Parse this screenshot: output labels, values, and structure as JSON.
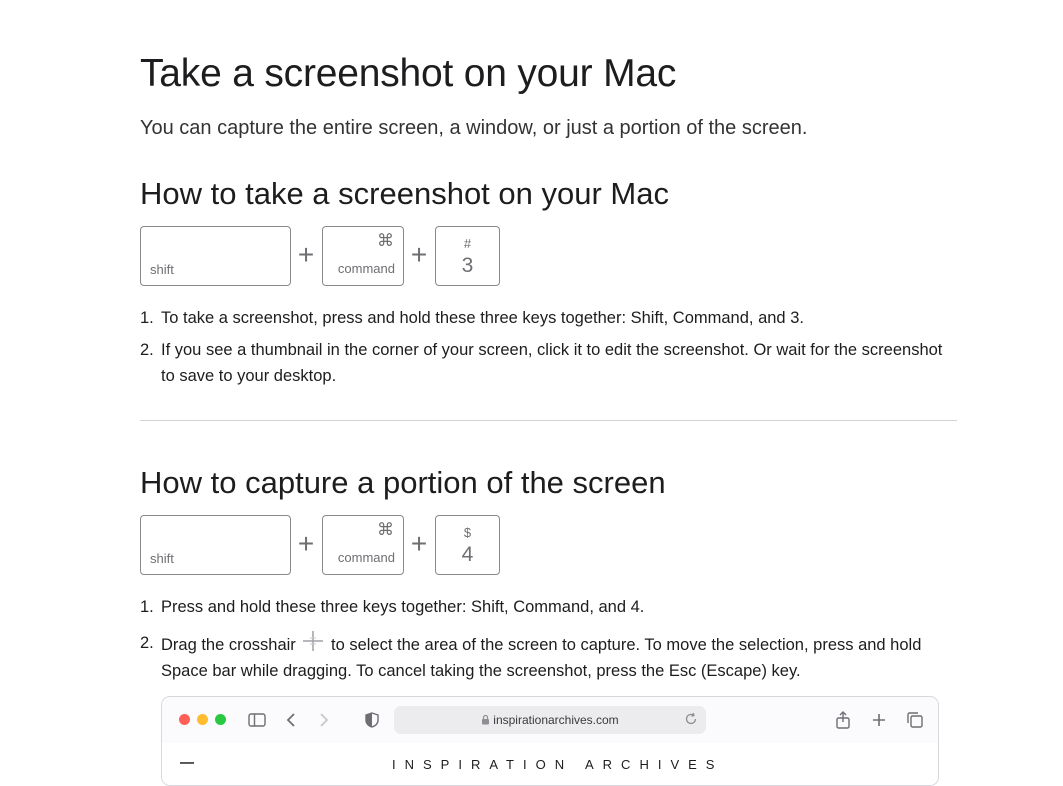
{
  "page": {
    "title": "Take a screenshot on your Mac",
    "intro": "You can capture the entire screen, a window, or just a portion of the screen."
  },
  "section1": {
    "heading": "How to take a screenshot on your Mac",
    "keys": {
      "shift": "shift",
      "command_symbol": "⌘",
      "command": "command",
      "num_symbol": "#",
      "num": "3",
      "plus": "+"
    },
    "steps": [
      {
        "num": "1.",
        "text": "To take a screenshot, press and hold these three keys together: Shift, Command, and 3."
      },
      {
        "num": "2.",
        "text": "If you see a thumbnail in the corner of your screen, click it to edit the screenshot. Or wait for the screenshot to save to your desktop."
      }
    ]
  },
  "section2": {
    "heading": "How to capture a portion of the screen",
    "keys": {
      "shift": "shift",
      "command_symbol": "⌘",
      "command": "command",
      "num_symbol": "$",
      "num": "4",
      "plus": "+"
    },
    "steps": [
      {
        "num": "1.",
        "text": "Press and hold these three keys together: Shift, Command, and 4."
      },
      {
        "num": "2.",
        "text_before": "Drag the crosshair",
        "text_after": "to select the area of the screen to capture. To move the selection, press and hold Space bar while dragging. To cancel taking the screenshot, press the Esc (Escape) key."
      }
    ]
  },
  "browser": {
    "url": "inspirationarchives.com",
    "site_name": "INSPIRATION ARCHIVES",
    "icons": [
      "sidebar-icon",
      "back-icon",
      "forward-icon",
      "shield-icon",
      "lock-icon",
      "reload-icon",
      "share-icon",
      "new-tab-icon",
      "tabs-icon",
      "menu-icon"
    ]
  },
  "colors": {
    "text": "#1d1d1f",
    "key_border": "#8a8a8e",
    "divider": "#d2d2d7",
    "traffic_red": "#ff5f57",
    "traffic_yellow": "#febc2e",
    "traffic_green": "#28c840"
  }
}
